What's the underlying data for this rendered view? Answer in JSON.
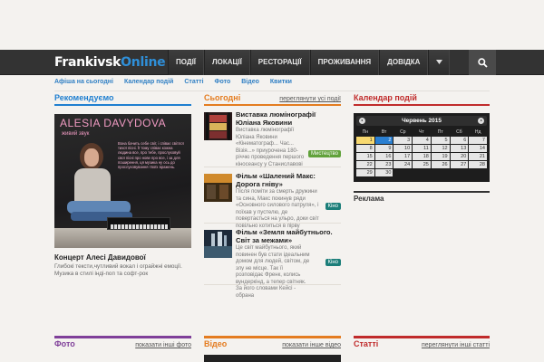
{
  "logo": {
    "part1": "Frankivsk",
    "part2": "Online"
  },
  "nav": {
    "items": [
      "ПОДІЇ",
      "ЛОКАЦІЇ",
      "РЕСТОРАЦІЇ",
      "ПРОЖИВАННЯ",
      "ДОВІДКА"
    ]
  },
  "subnav": {
    "items": [
      "Афіша на сьогодні",
      "Календар подій",
      "Статті",
      "Фото",
      "Відео",
      "Квитки"
    ]
  },
  "recommend": {
    "title": "Рекомендуємо",
    "poster_name": "ALESIA DAVYDOVA",
    "poster_sub": "живий звук",
    "poster_text": "Вона бачить себе світ, і співає світлої тихої пісні. Її тому співає кожна людина все, про тебе, прослуховуй свої пісні про нове про все, і за для поширення, ця музика ну ось до прослуховування твоїх вражень.",
    "caption": "Концерт Алесі Давидової",
    "desc": "Глибокі тексти,чутливий вокал і ограйжні емоції. Музика в стилі інді-поп та софт-рок"
  },
  "today": {
    "title": "Сьогодні",
    "more": "переглянути усі події",
    "events": [
      {
        "title": "Виставка люмінографії Юліана Яковини",
        "desc": "Виставка люмінографії Юліана Яковини «Кінематограф... Час... Візія...» приурочена 180-річчю проведення першого кіносеансу у Станиславові",
        "badge": "Мистецтво"
      },
      {
        "title": "Фільм «Шалений Макс: Дорога гніву»",
        "desc": "Після поміти за смерть дружини та сина, Макс покинув ряди «Основного силового патруля», і поїхав у пустелю, де повертається на ульро, доки світ повільно котиться в пірву",
        "badge": "Кіно"
      },
      {
        "title": "Фільм «Земля майбутнього. Світ за межами»",
        "desc": "Це світ майбутнього, який повинен був стати ідеальним домом для людей, світом, де злу не місце. Так її розповідає Френк, колись вундеркінд, а тепер світняк. За його словами Кейсі - обрана",
        "badge": "Кіно"
      }
    ]
  },
  "calendar": {
    "title": "Календар подій",
    "month": "Червень 2015",
    "dow": [
      "Пн",
      "Вт",
      "Ср",
      "Чт",
      "Пт",
      "Сб",
      "Нд"
    ],
    "weeks": [
      [
        "1",
        "2",
        "3",
        "4",
        "5",
        "6",
        "7"
      ],
      [
        "8",
        "9",
        "10",
        "11",
        "12",
        "13",
        "14"
      ],
      [
        "15",
        "16",
        "17",
        "18",
        "19",
        "20",
        "21"
      ],
      [
        "22",
        "23",
        "24",
        "25",
        "26",
        "27",
        "28"
      ],
      [
        "29",
        "30",
        "",
        "",
        "",
        "",
        ""
      ]
    ]
  },
  "ads": {
    "title": "Реклама"
  },
  "bottom": {
    "photo": {
      "title": "Фото",
      "more": "показати інші фото"
    },
    "video": {
      "title": "Відео",
      "more": "показати інше відео"
    },
    "articles": {
      "title": "Статті",
      "more": "переглянути інші статті"
    }
  }
}
